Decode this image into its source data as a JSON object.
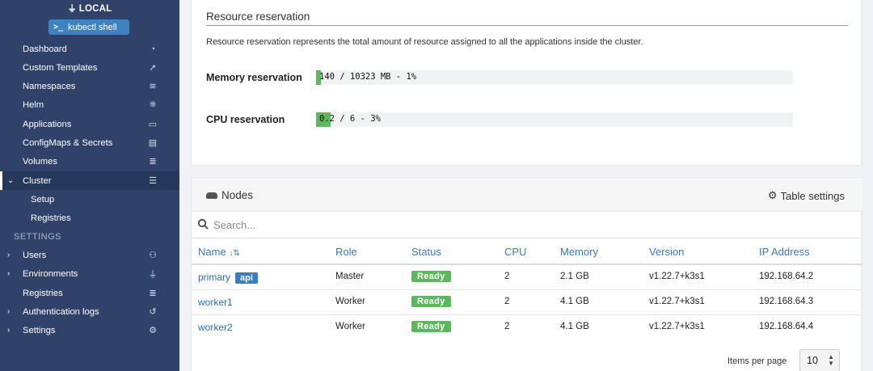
{
  "sidebar": {
    "environment": "LOCAL",
    "kubectl_shell": "kubectl shell",
    "items": [
      {
        "label": "Dashboard",
        "icon": "tachometer-icon",
        "glyph": "◔"
      },
      {
        "label": "Custom Templates",
        "icon": "rocket-icon",
        "glyph": "➚"
      },
      {
        "label": "Namespaces",
        "icon": "layers-icon",
        "glyph": "≋"
      },
      {
        "label": "Helm",
        "icon": "helm-icon",
        "glyph": "⎈"
      },
      {
        "label": "Applications",
        "icon": "laptop-icon",
        "glyph": "▭"
      },
      {
        "label": "ConfigMaps & Secrets",
        "icon": "file-icon",
        "glyph": "▤"
      },
      {
        "label": "Volumes",
        "icon": "database-icon",
        "glyph": "≣"
      },
      {
        "label": "Cluster",
        "icon": "server-icon",
        "glyph": "☰"
      },
      {
        "label": "Setup"
      },
      {
        "label": "Registries"
      }
    ],
    "settings_heading": "SETTINGS",
    "settings_items": [
      {
        "label": "Users",
        "icon": "users-icon",
        "glyph": "⚇"
      },
      {
        "label": "Environments",
        "icon": "plug-icon",
        "glyph": "⏚"
      },
      {
        "label": "Registries",
        "icon": "database-icon",
        "glyph": "≣"
      },
      {
        "label": "Authentication logs",
        "icon": "history-icon",
        "glyph": "↺"
      },
      {
        "label": "Settings",
        "icon": "cogs-icon",
        "glyph": "⚙"
      }
    ]
  },
  "resource_reservation": {
    "title": "Resource reservation",
    "description": "Resource reservation represents the total amount of resource assigned to all the applications inside the cluster.",
    "memory": {
      "label": "Memory reservation",
      "text": "140 / 10323 MB - 1%",
      "percent": 1
    },
    "cpu": {
      "label": "CPU reservation",
      "text": "0.2 / 6 - 3%",
      "percent": 3
    },
    "bar_color": "#5cb85c"
  },
  "nodes": {
    "title": "Nodes",
    "table_settings": "Table settings",
    "search_placeholder": "Search...",
    "columns": [
      "Name",
      "Role",
      "Status",
      "CPU",
      "Memory",
      "Version",
      "IP Address"
    ],
    "sort_indicator": "↓⇅",
    "rows": [
      {
        "name": "primary",
        "badge": "api",
        "role": "Master",
        "status": "Ready",
        "cpu": "2",
        "memory": "2.1 GB",
        "version": "v1.22.7+k3s1",
        "ip": "192.168.64.2"
      },
      {
        "name": "worker1",
        "badge": "",
        "role": "Worker",
        "status": "Ready",
        "cpu": "2",
        "memory": "4.1 GB",
        "version": "v1.22.7+k3s1",
        "ip": "192.168.64.3"
      },
      {
        "name": "worker2",
        "badge": "",
        "role": "Worker",
        "status": "Ready",
        "cpu": "2",
        "memory": "4.1 GB",
        "version": "v1.22.7+k3s1",
        "ip": "192.168.64.4"
      }
    ],
    "items_per_page_label": "Items per page",
    "items_per_page_value": "10"
  },
  "colors": {
    "sidebar": "#30426a",
    "accent": "#3e82bf",
    "ready": "#5cb85c",
    "link": "#2f6fb0"
  }
}
